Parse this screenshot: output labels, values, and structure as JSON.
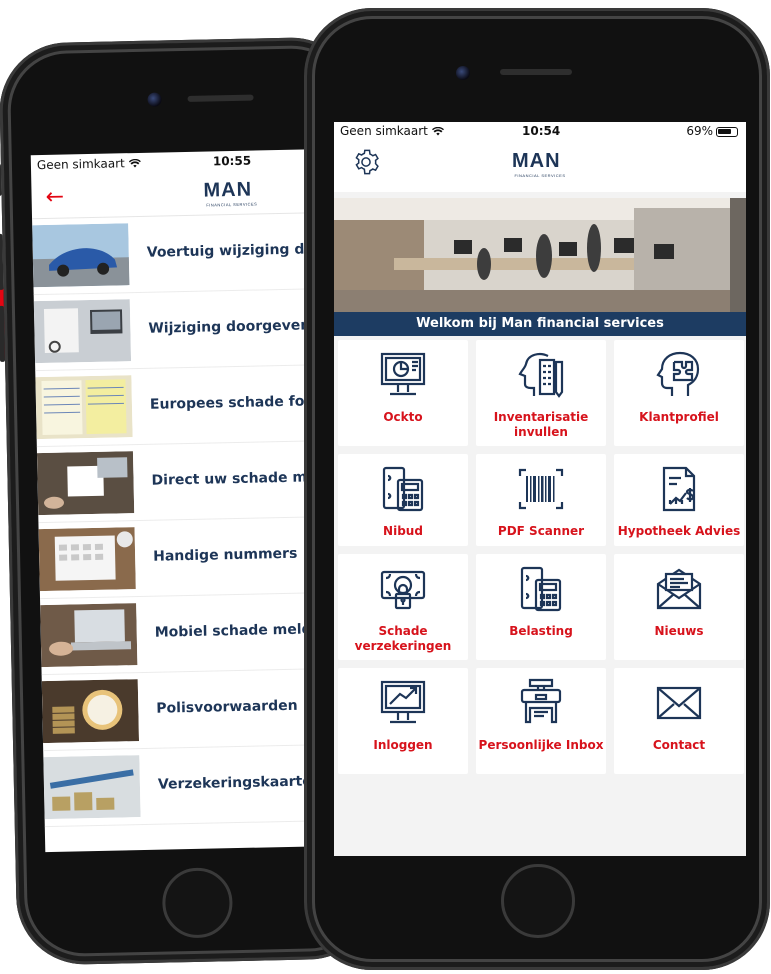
{
  "left_phone": {
    "status": {
      "carrier": "Geen simkaart",
      "time": "10:55"
    },
    "nav": {
      "back_icon": "arrow-left-icon",
      "logo_main": "MAN",
      "logo_sub": "FINANCIAL SERVICES"
    },
    "items": [
      {
        "label": "Voertuig wijziging doo"
      },
      {
        "label": "Wijziging doorgeven"
      },
      {
        "label": "Europees schade formu"
      },
      {
        "label": "Direct uw schade melde"
      },
      {
        "label": "Handige nummers"
      },
      {
        "label": "Mobiel schade melden"
      },
      {
        "label": "Polisvoorwaarden"
      },
      {
        "label": "Verzekeringskaarten"
      }
    ]
  },
  "right_phone": {
    "status": {
      "carrier": "Geen simkaart",
      "time": "10:54",
      "battery": "69%"
    },
    "header": {
      "settings_icon": "gear-icon",
      "logo_main": "MAN",
      "logo_sub": "FINANCIAL SERVICES"
    },
    "banner": {
      "caption": "Welkom bij Man financial services"
    },
    "tiles": [
      {
        "label": "Ockto",
        "icon": "monitor-chart-icon"
      },
      {
        "label": "Inventarisatie invullen",
        "icon": "head-checklist-icon"
      },
      {
        "label": "Klantprofiel",
        "icon": "head-puzzle-icon"
      },
      {
        "label": "Nibud",
        "icon": "calculator-money-icon"
      },
      {
        "label": "PDF Scanner",
        "icon": "barcode-icon"
      },
      {
        "label": "Hypotheek Advies",
        "icon": "document-chart-icon"
      },
      {
        "label": "Schade verzekeringen",
        "icon": "money-lock-icon"
      },
      {
        "label": "Belasting",
        "icon": "calculator-money-icon"
      },
      {
        "label": "Nieuws",
        "icon": "newsletter-icon"
      },
      {
        "label": "Inloggen",
        "icon": "monitor-login-icon"
      },
      {
        "label": "Persoonlijke Inbox",
        "icon": "mailbox-icon"
      },
      {
        "label": "Contact",
        "icon": "envelope-icon"
      }
    ]
  },
  "colors": {
    "brand_navy": "#1d3557",
    "accent_red": "#d7131c",
    "banner_bar": "#1d3c62"
  }
}
